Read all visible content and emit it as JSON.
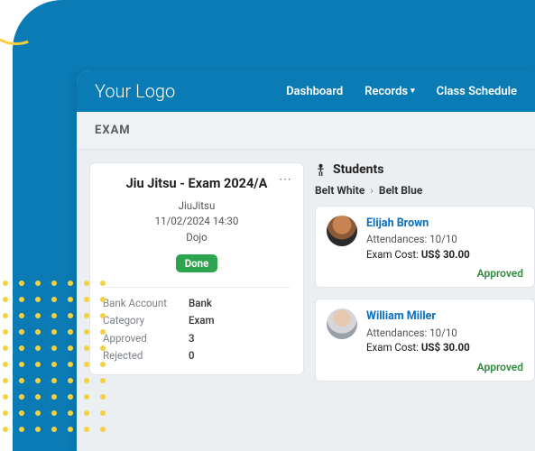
{
  "brand": "Your Logo",
  "nav": {
    "dashboard": "Dashboard",
    "records": "Records",
    "schedule": "Class Schedule"
  },
  "page_title": "EXAM",
  "exam": {
    "title": "Jiu Jitsu - Exam 2024/A",
    "sport": "JiuJitsu",
    "datetime": "11/02/2024 14:30",
    "location": "Dojo",
    "status": "Done",
    "rows": {
      "bank_account": {
        "k": "Bank Account",
        "v": "Bank"
      },
      "category": {
        "k": "Category",
        "v": "Exam"
      },
      "approved": {
        "k": "Approved",
        "v": "3"
      },
      "rejected": {
        "k": "Rejected",
        "v": "0"
      }
    }
  },
  "students": {
    "heading": "Students",
    "breadcrumb": {
      "from": "Belt White",
      "to": "Belt Blue"
    },
    "attendances_label": "Attendances:",
    "cost_label": "Exam Cost:",
    "approved_label": "Approved",
    "list": [
      {
        "name": "Elijah Brown",
        "attendances": "10/10",
        "cost": "US$ 30.00"
      },
      {
        "name": "William Miller",
        "attendances": "10/10",
        "cost": "US$ 30.00"
      }
    ]
  }
}
